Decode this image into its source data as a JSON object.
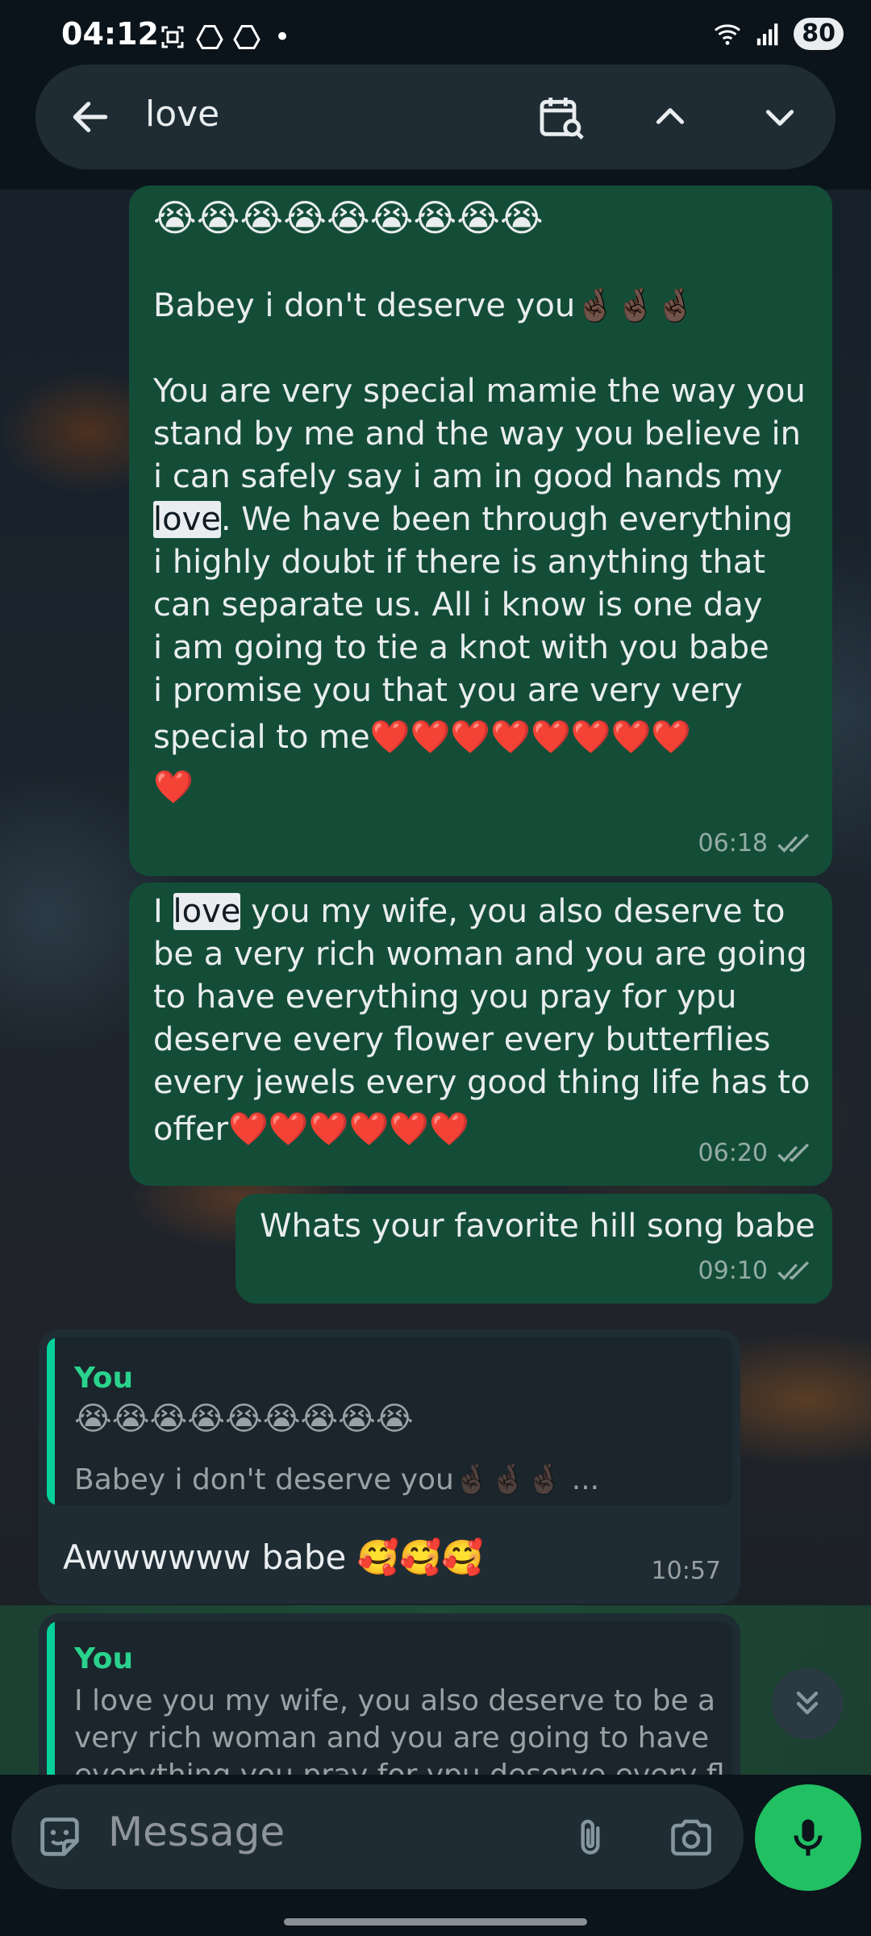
{
  "status_bar": {
    "time": "04:12",
    "battery": "80",
    "notification_dot": "•"
  },
  "search": {
    "query": "love"
  },
  "messages": [
    {
      "direction": "outgoing",
      "lines": [
        "😭😭😭😭😭😭😭😭😭",
        "",
        "Babey i don't deserve you🤞🏿🤞🏿🤞🏿",
        "",
        "You are very special mamie the way you",
        "stand by me and the way you believe in",
        "i can safely say i am in good hands my"
      ],
      "hl_line_pre": "",
      "hl_word": "love",
      "hl_line_post": ". We have been through everything",
      "lines_after": [
        "i highly doubt if there is anything that",
        "can separate us. All i know is one day",
        "i am going to tie a knot with you babe",
        "i promise you that you are very very",
        "special to me❤️❤️❤️❤️❤️❤️❤️❤️",
        "❤️"
      ],
      "time": "06:18"
    },
    {
      "direction": "outgoing",
      "hl_line_pre": "I ",
      "hl_word": "love",
      "hl_line_post": " you my wife, you also deserve to",
      "lines_after": [
        "be a very rich woman and you are going",
        "to have everything you pray for ypu",
        "deserve every flower every butterflies",
        "every jewels every good thing life has to",
        "offer❤️❤️❤️❤️❤️❤️"
      ],
      "time": "06:20"
    },
    {
      "direction": "outgoing",
      "text": "Whats your favorite hill song babe",
      "time": "09:10"
    },
    {
      "direction": "incoming",
      "quote_author": "You",
      "quote_line1": "😭😭😭😭😭😭😭😭😭",
      "quote_line2": "Babey i don't deserve you🤞🏿🤞🏿🤞🏿 ...",
      "text": "Awwwwww babe 🥰🥰🥰",
      "time": "10:57"
    },
    {
      "direction": "incoming",
      "quote_author": "You",
      "quote_lines": [
        "I love you my wife, you also deserve to be a",
        "very rich woman and you are going to have",
        "everything you pray for ypu deserve every fl"
      ]
    }
  ],
  "composer": {
    "placeholder": "Message"
  },
  "colors": {
    "outgoing_bubble": "#144d37",
    "incoming_bubble": "#1f2c33",
    "accent_green": "#21c063",
    "quote_author": "#2bd28c"
  }
}
